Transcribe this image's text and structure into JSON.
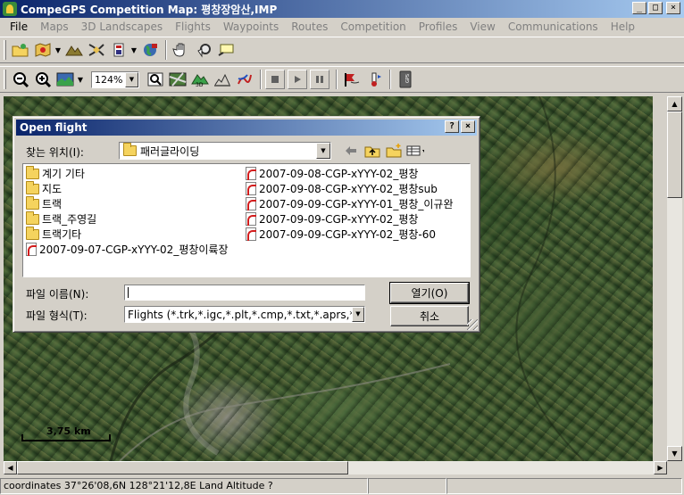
{
  "window": {
    "title": "CompeGPS Competition Map: 평창장암산,IMP"
  },
  "menu": [
    {
      "label": "File",
      "enabled": true
    },
    {
      "label": "Maps",
      "enabled": false
    },
    {
      "label": "3D Landscapes",
      "enabled": false
    },
    {
      "label": "Flights",
      "enabled": false
    },
    {
      "label": "Waypoints",
      "enabled": false
    },
    {
      "label": "Routes",
      "enabled": false
    },
    {
      "label": "Competition",
      "enabled": false
    },
    {
      "label": "Profiles",
      "enabled": false
    },
    {
      "label": "View",
      "enabled": false
    },
    {
      "label": "Communications",
      "enabled": false
    },
    {
      "label": "Help",
      "enabled": false
    }
  ],
  "toolbar2": {
    "zoom_value": "124%"
  },
  "map": {
    "scale_label": "3,75 km"
  },
  "status": {
    "coordinates": "coordinates 37°26'08,6N 128°21'12,8E Land Altitude ?"
  },
  "dialog": {
    "title": "Open flight",
    "look_in_label": "찾는 위치(I):",
    "look_in_value": "패러글라이딩",
    "items_col1": [
      {
        "name": "계기 기타",
        "type": "folder"
      },
      {
        "name": "지도",
        "type": "folder"
      },
      {
        "name": "트랙",
        "type": "folder"
      },
      {
        "name": "트랙_주영길",
        "type": "folder"
      },
      {
        "name": "트랙기타",
        "type": "folder"
      },
      {
        "name": "2007-09-07-CGP-xYYY-02_평창이륙장",
        "type": "file"
      }
    ],
    "items_col2": [
      {
        "name": "2007-09-08-CGP-xYYY-02_평창",
        "type": "file"
      },
      {
        "name": "2007-09-08-CGP-xYYY-02_평창sub",
        "type": "file"
      },
      {
        "name": "2007-09-09-CGP-xYYY-01_평창_이규완",
        "type": "file"
      },
      {
        "name": "2007-09-09-CGP-xYYY-02_평창",
        "type": "file"
      },
      {
        "name": "2007-09-09-CGP-xYYY-02_평창-60",
        "type": "file"
      }
    ],
    "filename_label": "파일 이름(N):",
    "filename_value": "",
    "filetype_label": "파일 형식(T):",
    "filetype_value": "Flights (*.trk,*.igc,*.plt,*.cmp,*.txt,*.aprs,*.igc)",
    "open_label": "열기(O)",
    "cancel_label": "취소"
  }
}
